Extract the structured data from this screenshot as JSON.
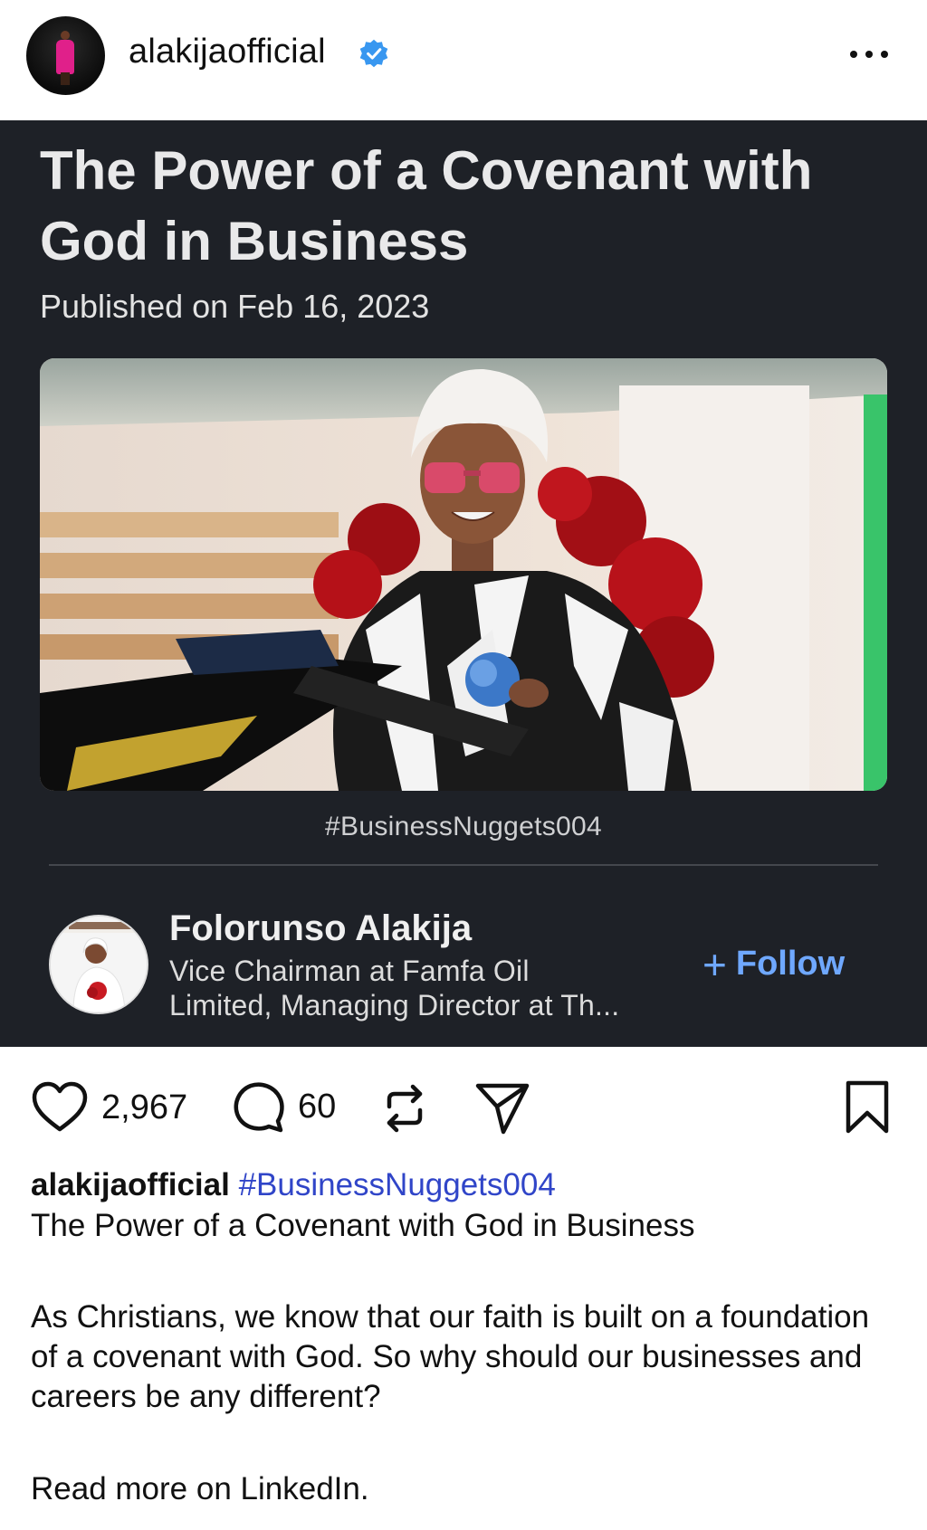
{
  "header": {
    "username": "alakijaofficial"
  },
  "article": {
    "title": "The Power of a Covenant with God in Business",
    "published": "Published on Feb 16, 2023",
    "hashtag": "#BusinessNuggets004"
  },
  "author": {
    "name": "Folorunso Alakija",
    "headline_line1": "Vice Chairman at Famfa Oil",
    "headline_line2": "Limited, Managing Director at Th...",
    "follow_label": "Follow"
  },
  "actions": {
    "likes": "2,967",
    "comments": "60"
  },
  "caption": {
    "username": "alakijaofficial",
    "hashtag": "#BusinessNuggets004",
    "title": "The Power of a Covenant with God in Business",
    "body": "As Christians, we know that our faith is built on a foundation of a covenant with God. So why should our businesses and careers be any different?",
    "more": "Read more on LinkedIn."
  },
  "colors": {
    "card_bg": "#1e2127",
    "follow": "#6fa8ff",
    "hashtag_link": "#3045c8",
    "verified": "#3897f0"
  }
}
